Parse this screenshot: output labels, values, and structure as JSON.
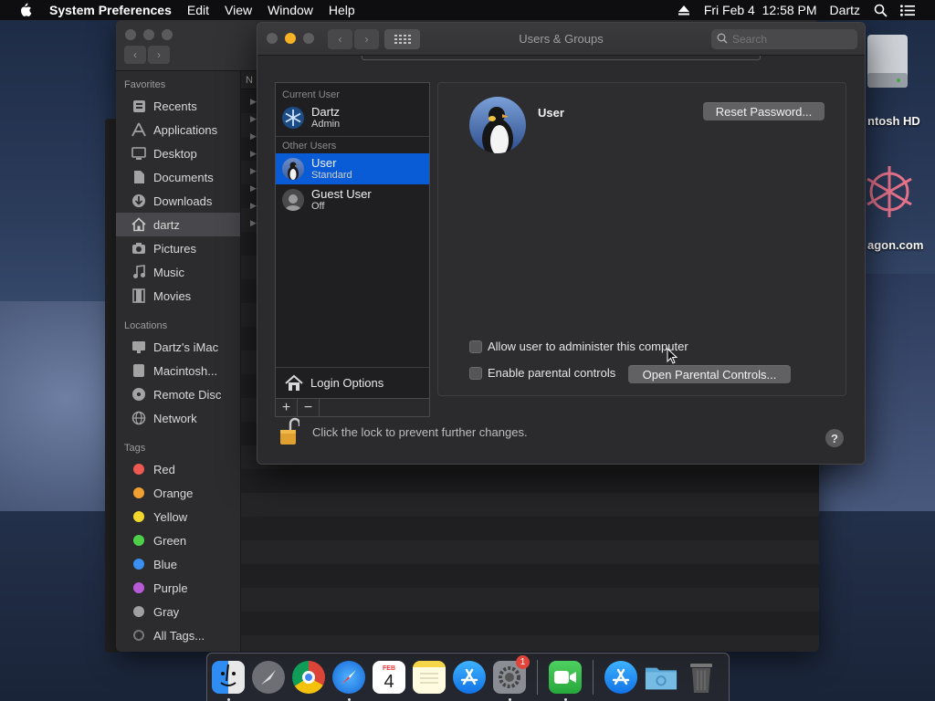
{
  "menubar": {
    "app_name": "System Preferences",
    "menus": [
      "Edit",
      "View",
      "Window",
      "Help"
    ],
    "clock": "Fri Feb 4  12:58 PM",
    "user": "Dartz"
  },
  "finder": {
    "favorites_header": "Favorites",
    "favorites": [
      "Recents",
      "Applications",
      "Desktop",
      "Documents",
      "Downloads",
      "dartz",
      "Pictures",
      "Music",
      "Movies"
    ],
    "selected_favorite": "dartz",
    "locations_header": "Locations",
    "locations": [
      "Dartz's iMac",
      "Macintosh...",
      "Remote Disc",
      "Network"
    ],
    "tags_header": "Tags",
    "tags": [
      {
        "label": "Red",
        "color": "#ee5a52"
      },
      {
        "label": "Orange",
        "color": "#f0a030"
      },
      {
        "label": "Yellow",
        "color": "#f2d72e"
      },
      {
        "label": "Green",
        "color": "#4fd04a"
      },
      {
        "label": "Blue",
        "color": "#3b8ff0"
      },
      {
        "label": "Purple",
        "color": "#b65ad6"
      },
      {
        "label": "Gray",
        "color": "#a0a0a0"
      },
      {
        "label": "All Tags...",
        "color": "#555555"
      }
    ],
    "column_header": "N"
  },
  "prefs": {
    "title": "Users & Groups",
    "search_placeholder": "Search",
    "current_user_header": "Current User",
    "current_user": {
      "name": "Dartz",
      "role": "Admin"
    },
    "other_users_header": "Other Users",
    "other_users": [
      {
        "name": "User",
        "role": "Standard"
      },
      {
        "name": "Guest User",
        "role": "Off"
      }
    ],
    "login_options": "Login Options",
    "selected_user_name": "User",
    "reset_password": "Reset Password...",
    "allow_admin": "Allow user to administer this computer",
    "parental_controls": "Enable parental controls",
    "open_parental": "Open Parental Controls...",
    "lock_text": "Click the lock to prevent further changes.",
    "help": "?"
  },
  "desktop": {
    "label1": "ntosh HD",
    "label2": "agon.com"
  },
  "dock": {
    "calendar_month": "FEB",
    "calendar_day": "4",
    "badge": "1"
  }
}
